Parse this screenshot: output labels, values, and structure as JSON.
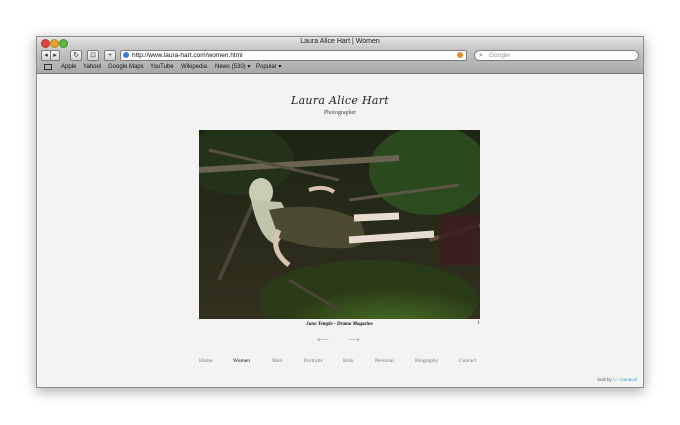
{
  "window": {
    "title": "Laura Alice Hart | Women"
  },
  "toolbar": {
    "back_icon": "back-arrow-icon",
    "forward_icon": "forward-arrow-icon",
    "reload_icon": "reload-icon",
    "url": "http://www.laura-hart.com/women.html",
    "search_placeholder": "Google"
  },
  "bookmarks": [
    "Apple",
    "Yahoo!",
    "Google Maps",
    "YouTube",
    "Wikipedia",
    "News (530) ▾",
    "Popular ▾"
  ],
  "site": {
    "logo_name": "Laura Alice Hart",
    "logo_subtitle": "Photographer",
    "caption": "Juno Temple - Drama Magazine",
    "page_number": "1",
    "prev_arrow": "⟵",
    "next_arrow": "⟶",
    "nav": [
      "Home",
      "Women",
      "Men",
      "Portraits",
      "Kids",
      "Personal",
      "Biography",
      "Contact"
    ],
    "active_nav": "Women",
    "built_by_prefix": "built by",
    "built_by_lime": "lime",
    "built_by_brand": "panacal"
  },
  "colors": {
    "accent_link": "#2aa7d8",
    "page_bg": "#f3f3f2"
  }
}
